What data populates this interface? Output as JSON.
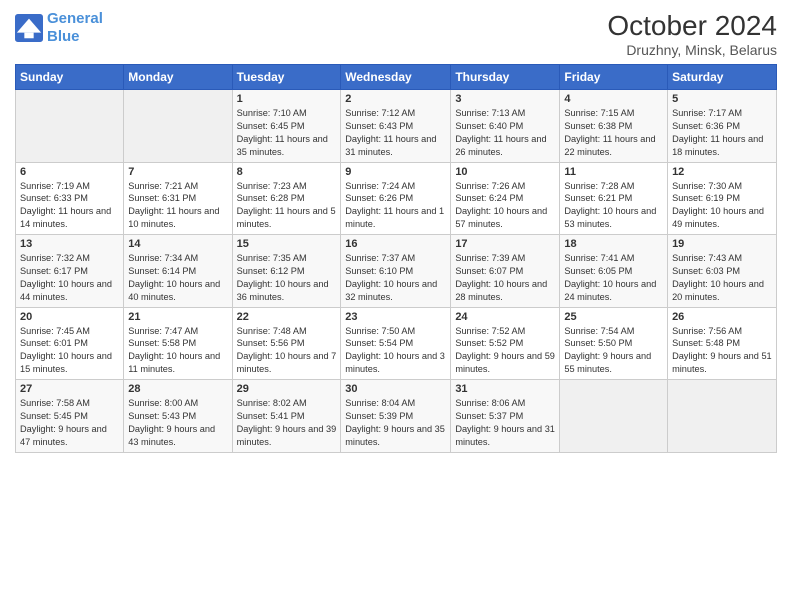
{
  "logo": {
    "line1": "General",
    "line2": "Blue"
  },
  "title": "October 2024",
  "subtitle": "Druzhny, Minsk, Belarus",
  "days_of_week": [
    "Sunday",
    "Monday",
    "Tuesday",
    "Wednesday",
    "Thursday",
    "Friday",
    "Saturday"
  ],
  "weeks": [
    [
      {
        "num": "",
        "info": ""
      },
      {
        "num": "",
        "info": ""
      },
      {
        "num": "1",
        "info": "Sunrise: 7:10 AM\nSunset: 6:45 PM\nDaylight: 11 hours and 35 minutes."
      },
      {
        "num": "2",
        "info": "Sunrise: 7:12 AM\nSunset: 6:43 PM\nDaylight: 11 hours and 31 minutes."
      },
      {
        "num": "3",
        "info": "Sunrise: 7:13 AM\nSunset: 6:40 PM\nDaylight: 11 hours and 26 minutes."
      },
      {
        "num": "4",
        "info": "Sunrise: 7:15 AM\nSunset: 6:38 PM\nDaylight: 11 hours and 22 minutes."
      },
      {
        "num": "5",
        "info": "Sunrise: 7:17 AM\nSunset: 6:36 PM\nDaylight: 11 hours and 18 minutes."
      }
    ],
    [
      {
        "num": "6",
        "info": "Sunrise: 7:19 AM\nSunset: 6:33 PM\nDaylight: 11 hours and 14 minutes."
      },
      {
        "num": "7",
        "info": "Sunrise: 7:21 AM\nSunset: 6:31 PM\nDaylight: 11 hours and 10 minutes."
      },
      {
        "num": "8",
        "info": "Sunrise: 7:23 AM\nSunset: 6:28 PM\nDaylight: 11 hours and 5 minutes."
      },
      {
        "num": "9",
        "info": "Sunrise: 7:24 AM\nSunset: 6:26 PM\nDaylight: 11 hours and 1 minute."
      },
      {
        "num": "10",
        "info": "Sunrise: 7:26 AM\nSunset: 6:24 PM\nDaylight: 10 hours and 57 minutes."
      },
      {
        "num": "11",
        "info": "Sunrise: 7:28 AM\nSunset: 6:21 PM\nDaylight: 10 hours and 53 minutes."
      },
      {
        "num": "12",
        "info": "Sunrise: 7:30 AM\nSunset: 6:19 PM\nDaylight: 10 hours and 49 minutes."
      }
    ],
    [
      {
        "num": "13",
        "info": "Sunrise: 7:32 AM\nSunset: 6:17 PM\nDaylight: 10 hours and 44 minutes."
      },
      {
        "num": "14",
        "info": "Sunrise: 7:34 AM\nSunset: 6:14 PM\nDaylight: 10 hours and 40 minutes."
      },
      {
        "num": "15",
        "info": "Sunrise: 7:35 AM\nSunset: 6:12 PM\nDaylight: 10 hours and 36 minutes."
      },
      {
        "num": "16",
        "info": "Sunrise: 7:37 AM\nSunset: 6:10 PM\nDaylight: 10 hours and 32 minutes."
      },
      {
        "num": "17",
        "info": "Sunrise: 7:39 AM\nSunset: 6:07 PM\nDaylight: 10 hours and 28 minutes."
      },
      {
        "num": "18",
        "info": "Sunrise: 7:41 AM\nSunset: 6:05 PM\nDaylight: 10 hours and 24 minutes."
      },
      {
        "num": "19",
        "info": "Sunrise: 7:43 AM\nSunset: 6:03 PM\nDaylight: 10 hours and 20 minutes."
      }
    ],
    [
      {
        "num": "20",
        "info": "Sunrise: 7:45 AM\nSunset: 6:01 PM\nDaylight: 10 hours and 15 minutes."
      },
      {
        "num": "21",
        "info": "Sunrise: 7:47 AM\nSunset: 5:58 PM\nDaylight: 10 hours and 11 minutes."
      },
      {
        "num": "22",
        "info": "Sunrise: 7:48 AM\nSunset: 5:56 PM\nDaylight: 10 hours and 7 minutes."
      },
      {
        "num": "23",
        "info": "Sunrise: 7:50 AM\nSunset: 5:54 PM\nDaylight: 10 hours and 3 minutes."
      },
      {
        "num": "24",
        "info": "Sunrise: 7:52 AM\nSunset: 5:52 PM\nDaylight: 9 hours and 59 minutes."
      },
      {
        "num": "25",
        "info": "Sunrise: 7:54 AM\nSunset: 5:50 PM\nDaylight: 9 hours and 55 minutes."
      },
      {
        "num": "26",
        "info": "Sunrise: 7:56 AM\nSunset: 5:48 PM\nDaylight: 9 hours and 51 minutes."
      }
    ],
    [
      {
        "num": "27",
        "info": "Sunrise: 7:58 AM\nSunset: 5:45 PM\nDaylight: 9 hours and 47 minutes."
      },
      {
        "num": "28",
        "info": "Sunrise: 8:00 AM\nSunset: 5:43 PM\nDaylight: 9 hours and 43 minutes."
      },
      {
        "num": "29",
        "info": "Sunrise: 8:02 AM\nSunset: 5:41 PM\nDaylight: 9 hours and 39 minutes."
      },
      {
        "num": "30",
        "info": "Sunrise: 8:04 AM\nSunset: 5:39 PM\nDaylight: 9 hours and 35 minutes."
      },
      {
        "num": "31",
        "info": "Sunrise: 8:06 AM\nSunset: 5:37 PM\nDaylight: 9 hours and 31 minutes."
      },
      {
        "num": "",
        "info": ""
      },
      {
        "num": "",
        "info": ""
      }
    ]
  ]
}
